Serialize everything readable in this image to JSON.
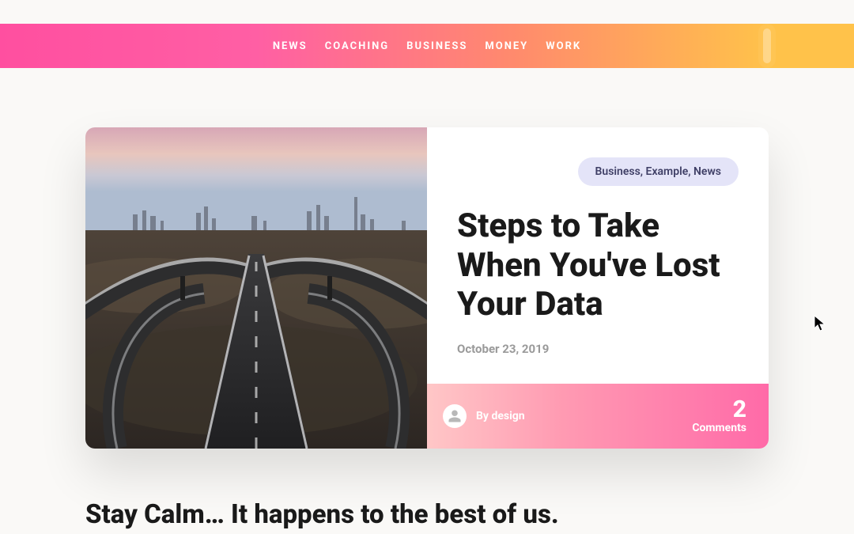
{
  "nav": {
    "items": [
      {
        "label": "NEWS"
      },
      {
        "label": "COACHING"
      },
      {
        "label": "BUSINESS"
      },
      {
        "label": "MONEY"
      },
      {
        "label": "WORK"
      }
    ]
  },
  "post": {
    "categories": "Business, Example, News",
    "title": "Steps to Take When You've Lost Your Data",
    "date": "October 23, 2019",
    "author_by": "By design",
    "comments_count": "2",
    "comments_label": "Comments"
  },
  "section": {
    "heading": "Stay Calm… It happens to the best of us."
  }
}
